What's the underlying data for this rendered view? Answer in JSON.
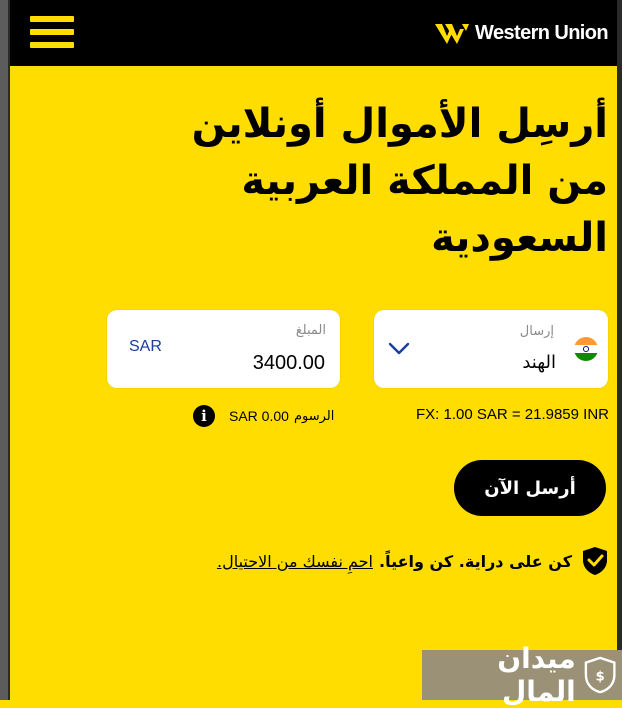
{
  "header": {
    "brand": "Western Union",
    "brand_color": "#ffdd00"
  },
  "hero": {
    "title_line1": "أرسِل الأموال أونلاين",
    "title_line2": "من المملكة العربية",
    "title_line3": "السعودية"
  },
  "send_from": {
    "label": "إرسال",
    "country": "الهند",
    "flag_icon": "india-flag-icon"
  },
  "amount": {
    "label": "المبلغ",
    "value": "3400.00",
    "currency": "SAR"
  },
  "fx": {
    "text": "FX: 1.00 SAR = 21.9859 INR"
  },
  "fees": {
    "label": "الرسوم",
    "amount": "SAR 0.00"
  },
  "actions": {
    "send_now": "أرسل الآن"
  },
  "notice": {
    "text": "كن على دراية. كن واعياً.",
    "link": "احمِ نفسك من الاحتيال."
  },
  "watermark": {
    "text": "ميدان المال"
  },
  "colors": {
    "accent": "#ffdd00",
    "dark": "#000000",
    "currency_blue": "#1a3d9c"
  }
}
